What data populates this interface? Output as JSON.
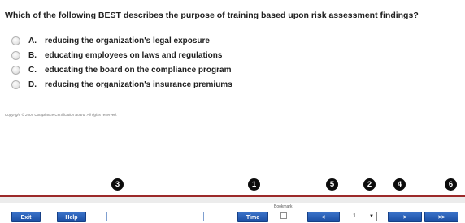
{
  "question": {
    "text": "Which of the following BEST describes the purpose of training based upon risk assessment findings?"
  },
  "options": [
    {
      "letter": "A.",
      "text": "reducing the organization's legal exposure"
    },
    {
      "letter": "B.",
      "text": "educating employees on laws and regulations"
    },
    {
      "letter": "C.",
      "text": "educating the board on the compliance program"
    },
    {
      "letter": "D.",
      "text": "reducing the organization's insurance premiums"
    }
  ],
  "copyright": "Copyright © 2009 Compliance Certification Board. All rights reserved.",
  "markers": {
    "one": "1",
    "two": "2",
    "three": "3",
    "four": "4",
    "five": "5",
    "six": "6"
  },
  "toolbar": {
    "exit_label": "Exit",
    "help_label": "Help",
    "search_value": "",
    "time_label": "Time",
    "bookmark_label": "Bookmark",
    "prev_label": "<",
    "page_value": "1",
    "next_label": ">",
    "last_label": ">>"
  },
  "colors": {
    "button_blue": "#2a5fb8",
    "accent_red": "#9c2a2a"
  }
}
